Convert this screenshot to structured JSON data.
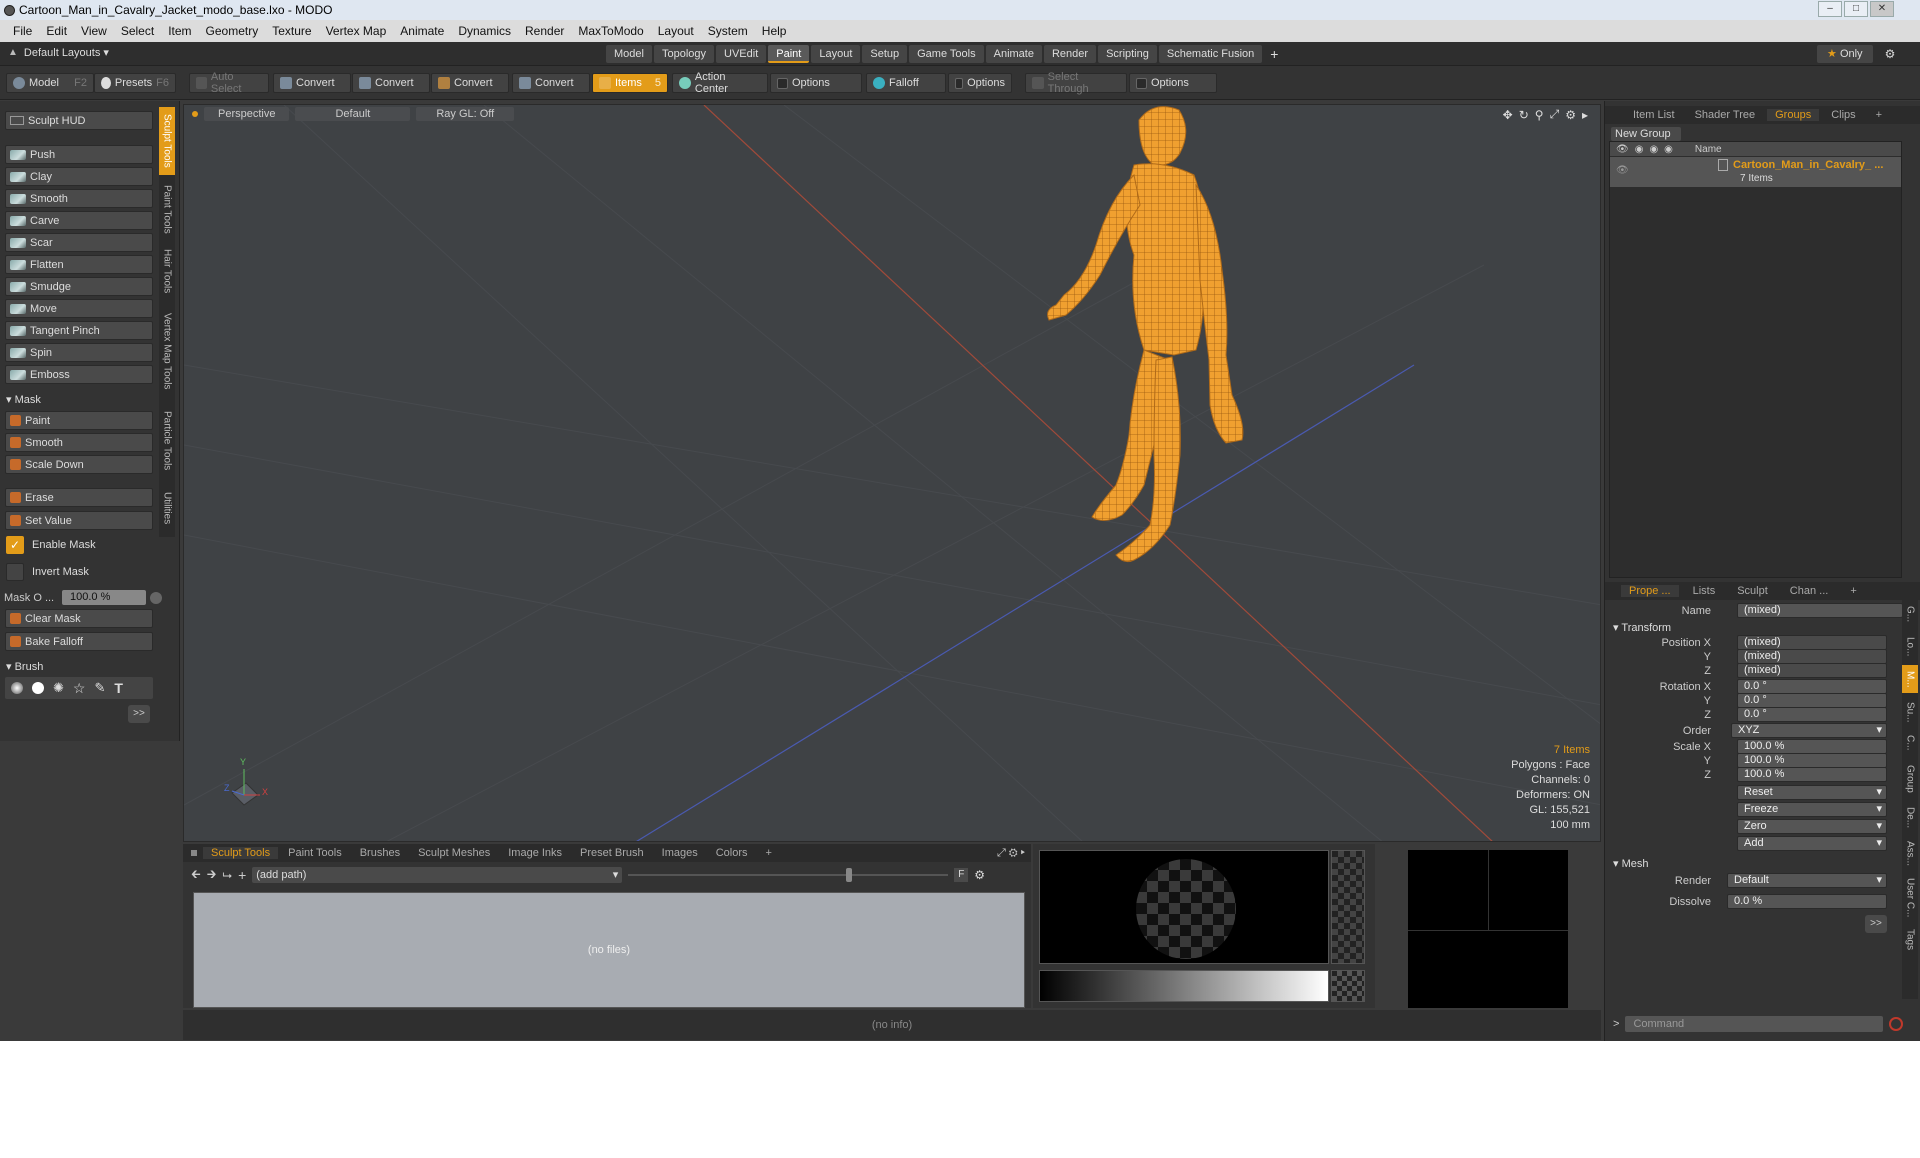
{
  "window": {
    "title": "Cartoon_Man_in_Cavalry_Jacket_modo_base.lxo - MODO"
  },
  "menubar": {
    "items": [
      "File",
      "Edit",
      "View",
      "Select",
      "Item",
      "Geometry",
      "Texture",
      "Vertex Map",
      "Animate",
      "Dynamics",
      "Render",
      "MaxToModo",
      "Layout",
      "System",
      "Help"
    ]
  },
  "layoutbar": {
    "layout_dropdown": "Default Layouts",
    "tabs": [
      "Model",
      "Topology",
      "UVEdit",
      "Paint",
      "Layout",
      "Setup",
      "Game Tools",
      "Animate",
      "Render",
      "Scripting",
      "Schematic Fusion"
    ],
    "active_tab": "Paint",
    "only_label": "Only"
  },
  "toolbar": {
    "model": "Model",
    "model_key": "F2",
    "presets": "Presets",
    "presets_key": "F6",
    "auto_select": "Auto Select",
    "convert": "Convert",
    "items": "Items",
    "items_key": "5",
    "action_center": "Action Center",
    "options": "Options",
    "falloff": "Falloff",
    "select_through": "Select Through"
  },
  "left_panel": {
    "hud": "Sculpt HUD",
    "tools": [
      "Push",
      "Clay",
      "Smooth",
      "Carve",
      "Scar",
      "Flatten",
      "Smudge",
      "Move",
      "Tangent Pinch",
      "Spin",
      "Emboss"
    ],
    "mask_header": "Mask",
    "mask_tools": [
      "Paint",
      "Smooth",
      "Scale Down"
    ],
    "erase": "Erase",
    "set_value": "Set Value",
    "enable_mask": "Enable Mask",
    "invert_mask": "Invert Mask",
    "mask_opacity_label": "Mask O ...",
    "mask_opacity_value": "100.0 %",
    "clear_mask": "Clear Mask",
    "bake_falloff": "Bake Falloff",
    "brush_header": "Brush",
    "more": ">>",
    "vertical_tabs": [
      "Sculpt Tools",
      "Paint Tools",
      "Hair Tools",
      "Vertex Map Tools",
      "Particle Tools",
      "Utilities"
    ]
  },
  "viewport": {
    "view": "Perspective",
    "shading": "Default",
    "raygl": "Ray GL: Off",
    "info": {
      "items": "7 Items",
      "polygons": "Polygons : Face",
      "channels": "Channels: 0",
      "deformers": "Deformers: ON",
      "gl": "GL: 155,521",
      "scale": "100 mm"
    },
    "axis_labels": [
      "Y",
      "X",
      "Z"
    ]
  },
  "bottom_panel": {
    "tabs": [
      "Sculpt Tools",
      "Paint Tools",
      "Brushes",
      "Sculpt Meshes",
      "Image Inks",
      "Preset Brush",
      "Images",
      "Colors"
    ],
    "active_tab": "Sculpt Tools",
    "path": "(add path)",
    "empty": "(no files)",
    "f_label": "F"
  },
  "status": {
    "info": "(no info)"
  },
  "right_panel": {
    "tabs": [
      "Item List",
      "Shader Tree",
      "Groups",
      "Clips"
    ],
    "active_tab": "Groups",
    "new_group": "New Group",
    "col_name": "Name",
    "group_name": "Cartoon_Man_in_Cavalry_ ...",
    "group_count": "7 Items",
    "prop_tabs": [
      "Prope ...",
      "Lists",
      "Sculpt",
      "Chan ..."
    ],
    "active_prop_tab": "Prope ...",
    "name_label": "Name",
    "name_value": "(mixed)",
    "transform_header": "Transform",
    "position_label": "Position X",
    "pos": [
      "(mixed)",
      "(mixed)",
      "(mixed)"
    ],
    "rotation_label": "Rotation X",
    "rot": [
      "0.0 °",
      "0.0 °",
      "0.0 °"
    ],
    "y_label": "Y",
    "z_label": "Z",
    "order_label": "Order",
    "order_value": "XYZ",
    "scale_label": "Scale X",
    "scale": [
      "100.0 %",
      "100.0 %",
      "100.0 %"
    ],
    "actions": [
      "Reset",
      "Freeze",
      "Zero",
      "Add"
    ],
    "mesh_header": "Mesh",
    "render_label": "Render",
    "render_value": "Default",
    "dissolve_label": "Dissolve",
    "dissolve_value": "0.0 %",
    "more": ">>",
    "command_placeholder": "Command",
    "prompt": ">",
    "side_tabs": [
      "G...",
      "Lo...",
      "M...",
      "Su...",
      "C...",
      "Group",
      "De...",
      "Ass...",
      "User C...",
      "Tags"
    ]
  },
  "colors": {
    "accent": "#e39c19",
    "viewport_bg": "#3f4245",
    "mesh": "#f0a030"
  }
}
